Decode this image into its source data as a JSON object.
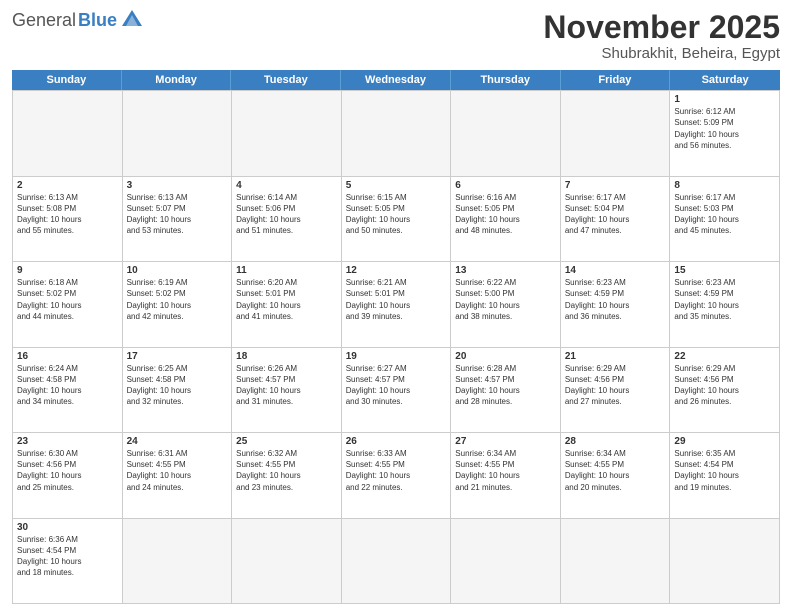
{
  "header": {
    "logo_general": "General",
    "logo_blue": "Blue",
    "month": "November 2025",
    "location": "Shubrakhit, Beheira, Egypt"
  },
  "weekdays": [
    "Sunday",
    "Monday",
    "Tuesday",
    "Wednesday",
    "Thursday",
    "Friday",
    "Saturday"
  ],
  "weeks": [
    [
      {
        "day": "",
        "text": "",
        "empty": true
      },
      {
        "day": "",
        "text": "",
        "empty": true
      },
      {
        "day": "",
        "text": "",
        "empty": true
      },
      {
        "day": "",
        "text": "",
        "empty": true
      },
      {
        "day": "",
        "text": "",
        "empty": true
      },
      {
        "day": "",
        "text": "",
        "empty": true
      },
      {
        "day": "1",
        "text": "Sunrise: 6:12 AM\nSunset: 5:09 PM\nDaylight: 10 hours\nand 56 minutes.",
        "empty": false
      }
    ],
    [
      {
        "day": "2",
        "text": "Sunrise: 6:13 AM\nSunset: 5:08 PM\nDaylight: 10 hours\nand 55 minutes.",
        "empty": false
      },
      {
        "day": "3",
        "text": "Sunrise: 6:13 AM\nSunset: 5:07 PM\nDaylight: 10 hours\nand 53 minutes.",
        "empty": false
      },
      {
        "day": "4",
        "text": "Sunrise: 6:14 AM\nSunset: 5:06 PM\nDaylight: 10 hours\nand 51 minutes.",
        "empty": false
      },
      {
        "day": "5",
        "text": "Sunrise: 6:15 AM\nSunset: 5:05 PM\nDaylight: 10 hours\nand 50 minutes.",
        "empty": false
      },
      {
        "day": "6",
        "text": "Sunrise: 6:16 AM\nSunset: 5:05 PM\nDaylight: 10 hours\nand 48 minutes.",
        "empty": false
      },
      {
        "day": "7",
        "text": "Sunrise: 6:17 AM\nSunset: 5:04 PM\nDaylight: 10 hours\nand 47 minutes.",
        "empty": false
      },
      {
        "day": "8",
        "text": "Sunrise: 6:17 AM\nSunset: 5:03 PM\nDaylight: 10 hours\nand 45 minutes.",
        "empty": false
      }
    ],
    [
      {
        "day": "9",
        "text": "Sunrise: 6:18 AM\nSunset: 5:02 PM\nDaylight: 10 hours\nand 44 minutes.",
        "empty": false
      },
      {
        "day": "10",
        "text": "Sunrise: 6:19 AM\nSunset: 5:02 PM\nDaylight: 10 hours\nand 42 minutes.",
        "empty": false
      },
      {
        "day": "11",
        "text": "Sunrise: 6:20 AM\nSunset: 5:01 PM\nDaylight: 10 hours\nand 41 minutes.",
        "empty": false
      },
      {
        "day": "12",
        "text": "Sunrise: 6:21 AM\nSunset: 5:01 PM\nDaylight: 10 hours\nand 39 minutes.",
        "empty": false
      },
      {
        "day": "13",
        "text": "Sunrise: 6:22 AM\nSunset: 5:00 PM\nDaylight: 10 hours\nand 38 minutes.",
        "empty": false
      },
      {
        "day": "14",
        "text": "Sunrise: 6:23 AM\nSunset: 4:59 PM\nDaylight: 10 hours\nand 36 minutes.",
        "empty": false
      },
      {
        "day": "15",
        "text": "Sunrise: 6:23 AM\nSunset: 4:59 PM\nDaylight: 10 hours\nand 35 minutes.",
        "empty": false
      }
    ],
    [
      {
        "day": "16",
        "text": "Sunrise: 6:24 AM\nSunset: 4:58 PM\nDaylight: 10 hours\nand 34 minutes.",
        "empty": false
      },
      {
        "day": "17",
        "text": "Sunrise: 6:25 AM\nSunset: 4:58 PM\nDaylight: 10 hours\nand 32 minutes.",
        "empty": false
      },
      {
        "day": "18",
        "text": "Sunrise: 6:26 AM\nSunset: 4:57 PM\nDaylight: 10 hours\nand 31 minutes.",
        "empty": false
      },
      {
        "day": "19",
        "text": "Sunrise: 6:27 AM\nSunset: 4:57 PM\nDaylight: 10 hours\nand 30 minutes.",
        "empty": false
      },
      {
        "day": "20",
        "text": "Sunrise: 6:28 AM\nSunset: 4:57 PM\nDaylight: 10 hours\nand 28 minutes.",
        "empty": false
      },
      {
        "day": "21",
        "text": "Sunrise: 6:29 AM\nSunset: 4:56 PM\nDaylight: 10 hours\nand 27 minutes.",
        "empty": false
      },
      {
        "day": "22",
        "text": "Sunrise: 6:29 AM\nSunset: 4:56 PM\nDaylight: 10 hours\nand 26 minutes.",
        "empty": false
      }
    ],
    [
      {
        "day": "23",
        "text": "Sunrise: 6:30 AM\nSunset: 4:56 PM\nDaylight: 10 hours\nand 25 minutes.",
        "empty": false
      },
      {
        "day": "24",
        "text": "Sunrise: 6:31 AM\nSunset: 4:55 PM\nDaylight: 10 hours\nand 24 minutes.",
        "empty": false
      },
      {
        "day": "25",
        "text": "Sunrise: 6:32 AM\nSunset: 4:55 PM\nDaylight: 10 hours\nand 23 minutes.",
        "empty": false
      },
      {
        "day": "26",
        "text": "Sunrise: 6:33 AM\nSunset: 4:55 PM\nDaylight: 10 hours\nand 22 minutes.",
        "empty": false
      },
      {
        "day": "27",
        "text": "Sunrise: 6:34 AM\nSunset: 4:55 PM\nDaylight: 10 hours\nand 21 minutes.",
        "empty": false
      },
      {
        "day": "28",
        "text": "Sunrise: 6:34 AM\nSunset: 4:55 PM\nDaylight: 10 hours\nand 20 minutes.",
        "empty": false
      },
      {
        "day": "29",
        "text": "Sunrise: 6:35 AM\nSunset: 4:54 PM\nDaylight: 10 hours\nand 19 minutes.",
        "empty": false
      }
    ],
    [
      {
        "day": "30",
        "text": "Sunrise: 6:36 AM\nSunset: 4:54 PM\nDaylight: 10 hours\nand 18 minutes.",
        "empty": false
      },
      {
        "day": "",
        "text": "",
        "empty": true
      },
      {
        "day": "",
        "text": "",
        "empty": true
      },
      {
        "day": "",
        "text": "",
        "empty": true
      },
      {
        "day": "",
        "text": "",
        "empty": true
      },
      {
        "day": "",
        "text": "",
        "empty": true
      },
      {
        "day": "",
        "text": "",
        "empty": true
      }
    ]
  ]
}
